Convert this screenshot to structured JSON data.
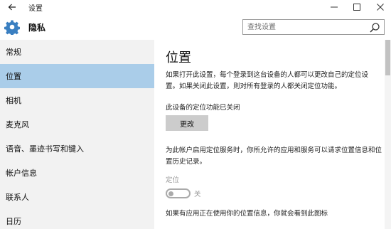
{
  "titlebar": {
    "title": "设置",
    "back_icon": "arrow-left-icon",
    "controls": [
      "minimize-icon",
      "maximize-icon",
      "close-icon"
    ]
  },
  "header": {
    "icon": "gear-icon",
    "title": "隐私",
    "search_placeholder": "查找设置",
    "search_icon": "search-icon"
  },
  "sidebar": {
    "items": [
      {
        "label": "常规"
      },
      {
        "label": "位置",
        "selected": true
      },
      {
        "label": "相机"
      },
      {
        "label": "麦克风"
      },
      {
        "label": "语音、墨迹书写和键入"
      },
      {
        "label": "帐户信息"
      },
      {
        "label": "联系人"
      },
      {
        "label": "日历"
      }
    ]
  },
  "main": {
    "title": "位置",
    "description": "如果打开此设置，每个登录到这台设备的人都可以更改自己的定位设置。如果关闭此设置，则对所有登录的人都关闭定位功能。",
    "status": "此设备的定位功能已关闭",
    "change_button": "更改",
    "account_description": "为此帐户启用定位服务时，你所允许的应用和服务可以请求位置信息和位置历史记录。",
    "location_label": "定位",
    "toggle_state": "关",
    "bottom_text": "如果有应用正在使用你的位置信息，你就会看到此图标"
  },
  "colors": {
    "selected_bg": "#aacde9",
    "sidebar_bg": "#f2f2f2",
    "button_bg": "#cccccc",
    "disabled_text": "#9a9a9a"
  }
}
